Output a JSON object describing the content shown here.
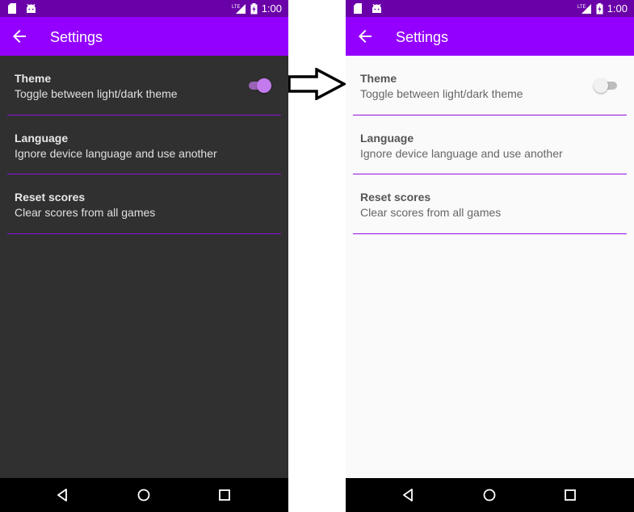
{
  "colors": {
    "status_bar": "#6a00a8",
    "app_bar": "#9400ff",
    "divider": "#8e10e0",
    "dark_bg": "#303030",
    "light_bg": "#fafafa",
    "switch_on_thumb": "#c27aed"
  },
  "status_bar": {
    "time": "1:00",
    "icons": [
      "sd-card-icon",
      "android-icon",
      "lte-signal-icon",
      "battery-charging-icon"
    ]
  },
  "app_bar": {
    "title": "Settings",
    "back_icon": "arrow-left-icon"
  },
  "settings": [
    {
      "title": "Theme",
      "subtitle": "Toggle between light/dark theme"
    },
    {
      "title": "Language",
      "subtitle": "Ignore device language and use another"
    },
    {
      "title": "Reset scores",
      "subtitle": "Clear scores from all games"
    }
  ],
  "screens": {
    "left": {
      "theme": "dark",
      "theme_switch_on": true
    },
    "right": {
      "theme": "light",
      "theme_switch_on": false
    }
  },
  "nav_bar": [
    "back-triangle-icon",
    "home-circle-icon",
    "recents-square-icon"
  ],
  "transition_arrow": "right-arrow-icon"
}
